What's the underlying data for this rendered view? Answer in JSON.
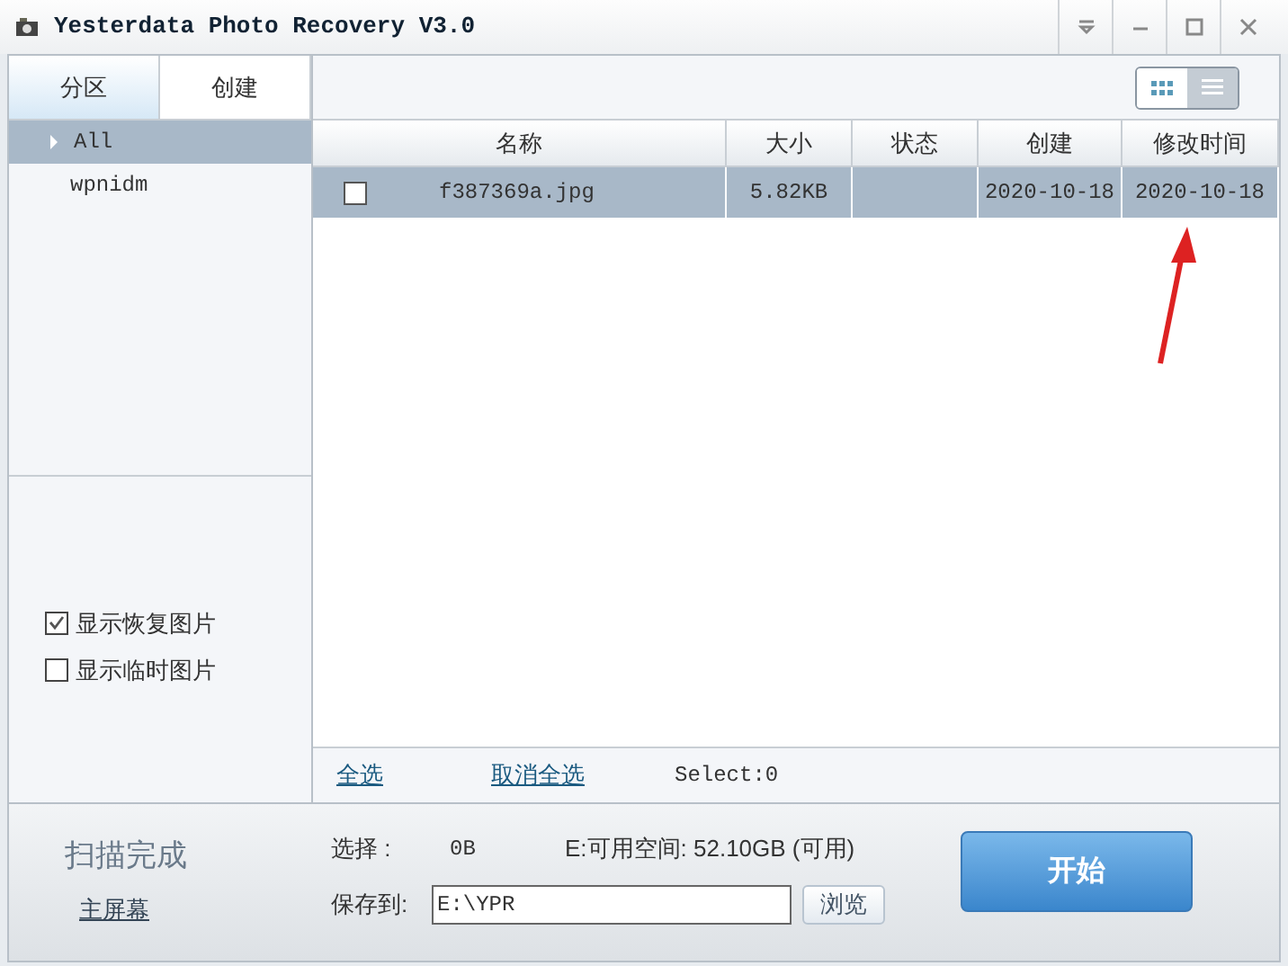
{
  "window": {
    "title": "Yesterdata Photo Recovery V3.0"
  },
  "tabs": [
    {
      "label": "分区",
      "selected": true
    },
    {
      "label": "创建",
      "selected": false
    }
  ],
  "tree": [
    {
      "label": "All",
      "selected": true,
      "expanded": false
    },
    {
      "label": "wpnidm",
      "selected": false
    }
  ],
  "options": [
    {
      "label": "显示恢复图片",
      "checked": true
    },
    {
      "label": "显示临时图片",
      "checked": false
    }
  ],
  "view_toggle": [
    {
      "kind": "grid",
      "selected": false
    },
    {
      "kind": "list",
      "selected": true
    }
  ],
  "table": {
    "columns": [
      "名称",
      "大小",
      "状态",
      "创建",
      "修改时间"
    ],
    "rows": [
      {
        "checked": false,
        "selected": true,
        "cells": [
          "f387369a.jpg",
          "5.82KB",
          "",
          "2020-10-18",
          "2020-10-18"
        ]
      }
    ]
  },
  "list_footer": {
    "select_all": "全选",
    "deselect_all": "取消全选",
    "select_count": "Select:0"
  },
  "status": {
    "scan_state": "扫描完成",
    "home_link": "主屏幕",
    "selection_label": "选择 :",
    "selection_value": "0B",
    "free_space": "E:可用空间: 52.10GB (可用)",
    "save_label": "保存到:",
    "save_path": "E:\\YPR",
    "browse": "浏览",
    "start": "开始"
  }
}
